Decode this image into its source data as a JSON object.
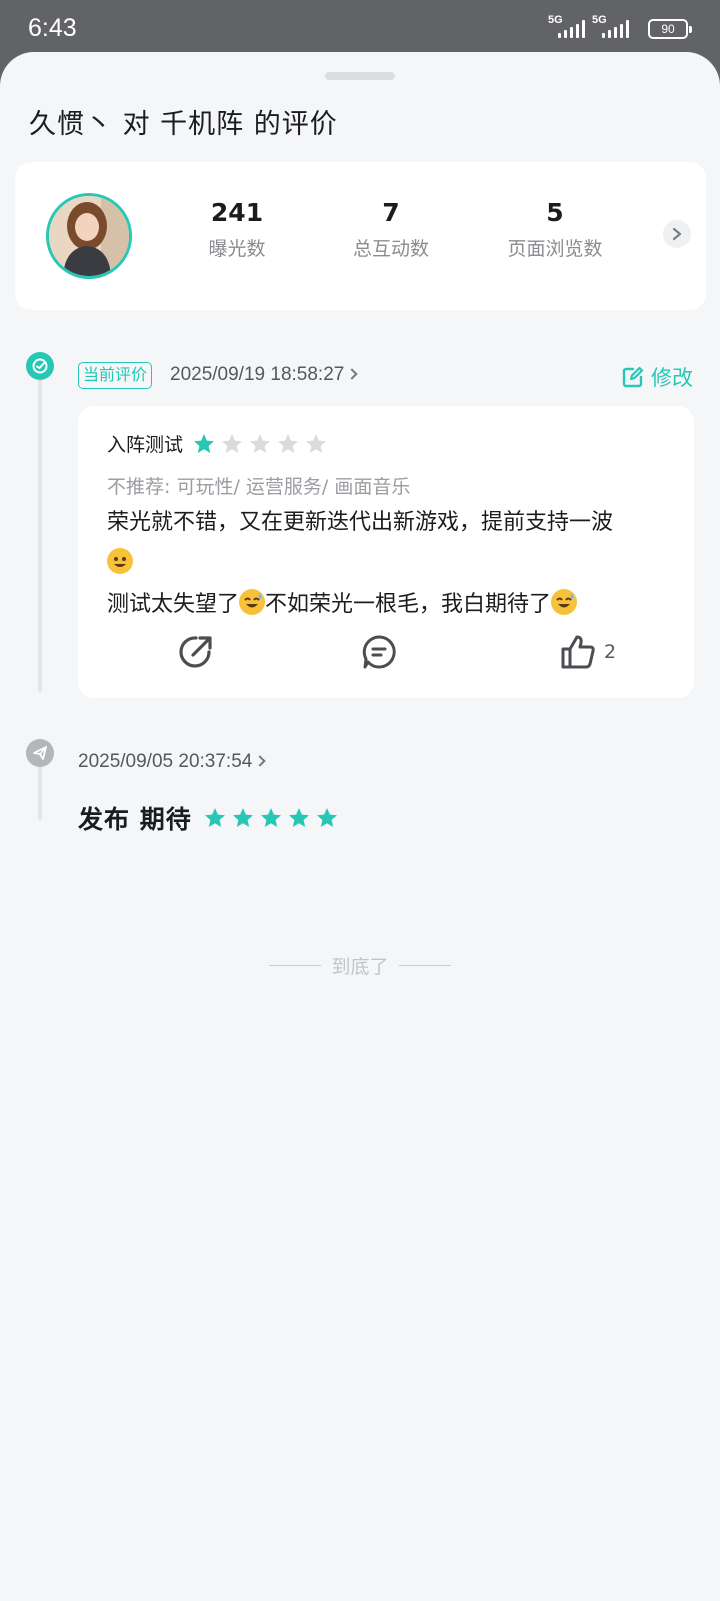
{
  "status_bar": {
    "time": "6:43",
    "network_1": "5G",
    "network_2": "5G",
    "battery": "90"
  },
  "title": "久惯丶 对 千机阵 的评价",
  "stats": [
    {
      "value": "241",
      "label": "曝光数"
    },
    {
      "value": "7",
      "label": "总互动数"
    },
    {
      "value": "5",
      "label": "页面浏览数"
    }
  ],
  "current_review": {
    "badge": "当前评价",
    "timestamp": "2025/09/19 18:58:27",
    "edit_label": "修改",
    "section": "入阵测试",
    "rating": 1,
    "rating_max": 5,
    "tags": "不推荐: 可玩性/ 运营服务/ 画面音乐",
    "text_line1": "荣光就不错，又在更新迭代出新游戏，提前支持一波",
    "text_line2a": "测试太失望了",
    "text_line2b": "不如荣光一根毛，我白期待了",
    "emoji_1": "smiley",
    "emoji_2": "sweat-smile",
    "like_count": "2"
  },
  "earlier": {
    "timestamp": "2025/09/05 20:37:54",
    "action": "发布 期待",
    "rating": 5,
    "rating_max": 5
  },
  "end_text": "到底了",
  "colors": {
    "accent": "#26c8b5",
    "star_empty": "#d9dbde",
    "emoji": "#f7c23a"
  }
}
